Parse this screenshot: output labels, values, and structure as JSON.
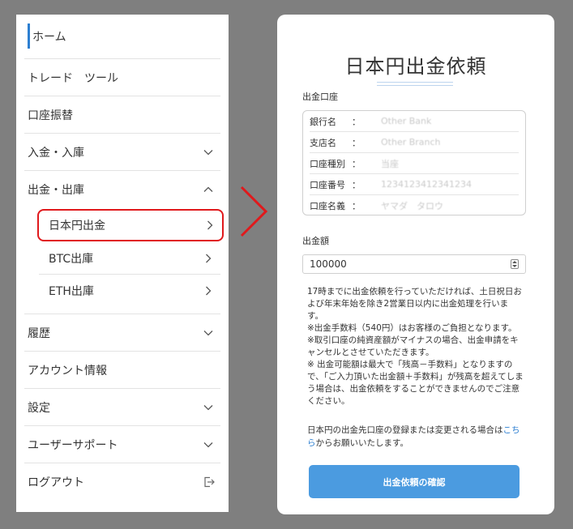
{
  "menu": {
    "home": "ホーム",
    "trade_tool": "トレード　ツール",
    "account_transfer": "口座振替",
    "deposit": "入金・入庫",
    "withdraw": "出金・出庫",
    "withdraw_sub": [
      "日本円出金",
      "BTC出庫",
      "ETH出庫"
    ],
    "history": "履歴",
    "account_info": "アカウント情報",
    "settings": "設定",
    "user_support": "ユーザーサポート",
    "logout": "ログアウト"
  },
  "form": {
    "title": "日本円出金依頼",
    "account_label": "出金口座",
    "account_rows": [
      {
        "key": "銀行名",
        "colon": "：",
        "value": "Other Bank"
      },
      {
        "key": "支店名",
        "colon": "：",
        "value": "Other Branch"
      },
      {
        "key": "口座種別",
        "colon": "：",
        "value": "当座"
      },
      {
        "key": "口座番号",
        "colon": "：",
        "value": "1234123412341234"
      },
      {
        "key": "口座名義",
        "colon": "：",
        "value": "ヤマダ　タロウ"
      }
    ],
    "amount_label": "出金額",
    "amount_value": "100000",
    "notes": "17時までに出金依頼を行っていただければ、土日祝日および年末年始を除き2営業日以内に出金処理を行います。\n※出金手数料（540円）はお客様のご負担となります。\n※取引口座の純資産額がマイナスの場合、出金申請をキャンセルとさせていただきます。\n※ 出金可能額は最大で「残高－手数料」となりますので、「ご入力頂いた出金額＋手数料」が残高を超えてしまう場合は、出金依頼をすることができませんのでご注意ください。",
    "register_note_before": "日本円の出金先口座の登録または変更される場合は",
    "register_link": "こちら",
    "register_note_after": "からお願いいたします。",
    "confirm_button": "出金依頼の確認"
  },
  "colors": {
    "accent": "#2d7fd1",
    "highlight_red": "#e0191c",
    "button": "#4b9be0",
    "backdrop": "#7f7f7f"
  }
}
